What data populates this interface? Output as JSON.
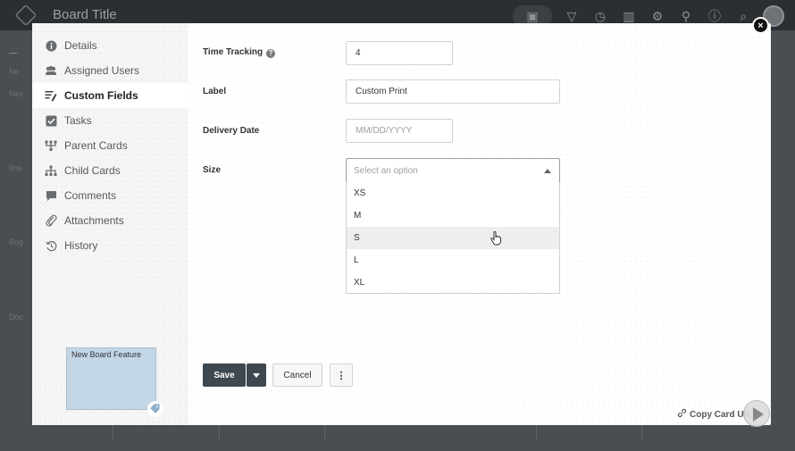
{
  "app": {
    "board_title": "Board Title"
  },
  "board": {
    "stubs": [
      "Ne",
      "Nev",
      "Imp",
      "Bug",
      "Doc"
    ]
  },
  "modal": {
    "nav": [
      {
        "label": "Details",
        "icon": "info-icon",
        "active": false
      },
      {
        "label": "Assigned Users",
        "icon": "users-icon",
        "active": false
      },
      {
        "label": "Custom Fields",
        "icon": "edit-icon",
        "active": true
      },
      {
        "label": "Tasks",
        "icon": "checkbox-icon",
        "active": false
      },
      {
        "label": "Parent Cards",
        "icon": "parent-cards-icon",
        "active": false
      },
      {
        "label": "Child Cards",
        "icon": "hierarchy-icon",
        "active": false
      },
      {
        "label": "Comments",
        "icon": "comment-icon",
        "active": false
      },
      {
        "label": "Attachments",
        "icon": "paperclip-icon",
        "active": false
      },
      {
        "label": "History",
        "icon": "history-icon",
        "active": false
      }
    ],
    "card_preview": {
      "title": "New Board Feature",
      "color": "#c3d6e6"
    },
    "fields": {
      "time_tracking": {
        "label": "Time Tracking",
        "value": "4"
      },
      "label": {
        "label": "Label",
        "value": "Custom Print"
      },
      "delivery_date": {
        "label": "Delivery Date",
        "placeholder": "MM/DD/YYYY"
      },
      "size": {
        "label": "Size",
        "placeholder": "Select an option",
        "options": [
          "XS",
          "M",
          "S",
          "L",
          "XL"
        ],
        "hovered": "S"
      }
    },
    "actions": {
      "save": "Save",
      "cancel": "Cancel",
      "more": "⋮"
    },
    "copy_url": "Copy Card UR",
    "close": "×"
  },
  "colors": {
    "primary_button": "#3e4850",
    "accent": "#222222"
  }
}
